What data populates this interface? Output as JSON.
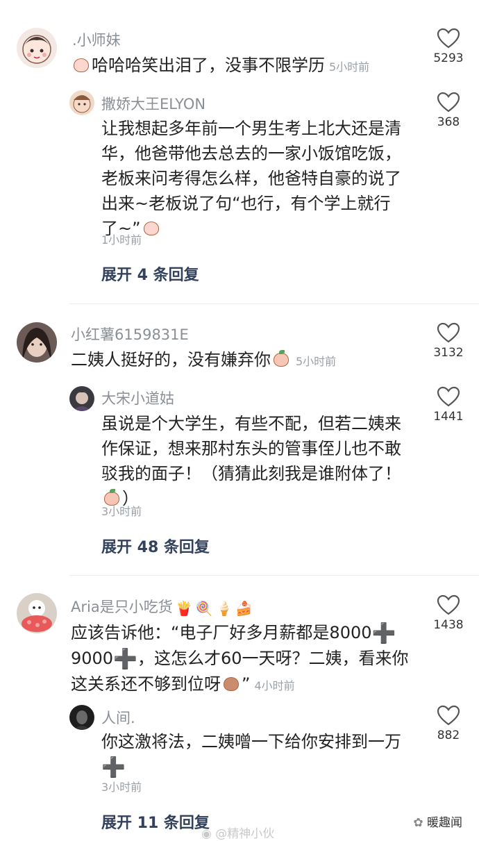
{
  "comments": [
    {
      "name": ".小师妹",
      "text": "哈哈哈笑出泪了，没事不限学历",
      "time": "5小时前",
      "likes": "5293",
      "reply": {
        "name": "撒娇大王ELYON",
        "lines": [
          "让我想起多年前一个男生考上北大还是清",
          "华，他爸带他去总去的一家小饭馆吃饭，",
          "老板来问考得怎么样，他爸特自豪的说了",
          "出来~老板说了句“也行，有个学上就行",
          "了~”"
        ],
        "time": "1小时前",
        "likes": "368"
      },
      "expand": "展开 4 条回复"
    },
    {
      "name": "小红薯6159831E",
      "text": "二姨人挺好的，没有嫌弃你",
      "time": "5小时前",
      "likes": "3132",
      "reply": {
        "name": "大宋小道姑",
        "lines": [
          "虽说是个大学生，有些不配，但若二姨来",
          "作保证，想来那村东头的管事侄儿也不敢",
          "驳我的面子！（猜猜此刻我是谁附体了！",
          "）"
        ],
        "time": "3小时前",
        "likes": "1441"
      },
      "expand": "展开 48 条回复"
    },
    {
      "name": "Aria是只小吃货",
      "lines": [
        "应该告诉他：“电子厂好多月薪都是8000",
        "9000",
        "，这怎么才60一天呀？二姨，看来你",
        "这关系还不够到位呀",
        "”"
      ],
      "time": "4小时前",
      "likes": "1438",
      "reply": {
        "name": "人间.",
        "lines": [
          "你这激将法，二姨噌一下给你安排到一万"
        ],
        "time": "3小时前",
        "likes": "882"
      },
      "expand": "展开 11 条回复"
    }
  ],
  "icons": {
    "like": "heart-outline-icon",
    "reply_action": "expand-replies"
  },
  "watermark": {
    "weibo": "@精神小伙",
    "brand": "暖趣闻"
  }
}
